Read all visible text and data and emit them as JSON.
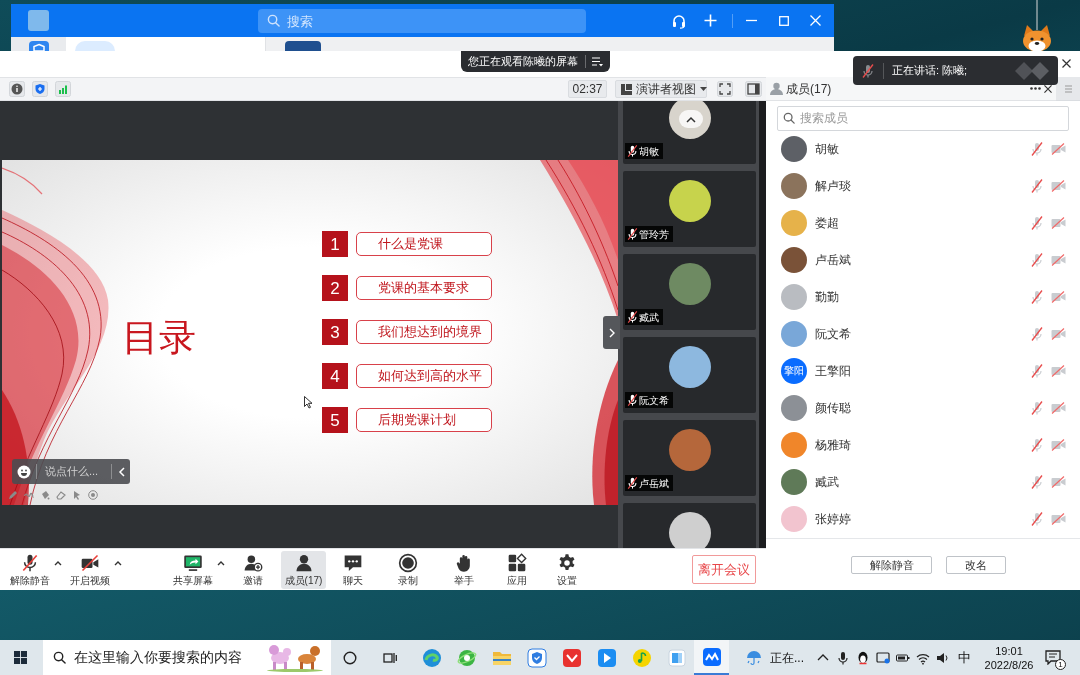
{
  "background_window": {
    "search": {
      "placeholder": "搜索"
    }
  },
  "meeting": {
    "banner": "您正在观看陈曦的屏幕",
    "timer": "02:37",
    "view_mode": "演讲者视图",
    "slide": {
      "title": "目录",
      "items": [
        {
          "number": "1",
          "label": "什么是党课"
        },
        {
          "number": "2",
          "label": "党课的基本要求"
        },
        {
          "number": "3",
          "label": "我们想达到的境界"
        },
        {
          "number": "4",
          "label": "如何达到高的水平"
        },
        {
          "number": "5",
          "label": "后期党课计划"
        }
      ]
    },
    "chat_input": {
      "placeholder": "说点什么..."
    },
    "video_tiles": [
      {
        "kind": "named",
        "name": "胡敏",
        "mic_muted": true
      },
      {
        "kind": "named",
        "name": "管玲芳",
        "mic_muted": true
      },
      {
        "kind": "named",
        "name": "臧武",
        "mic_muted": true
      },
      {
        "kind": "named",
        "name": "阮文希",
        "mic_muted": true
      },
      {
        "kind": "named",
        "name": "卢岳斌",
        "mic_muted": true
      },
      {
        "kind": "cut"
      }
    ],
    "toolbar": [
      {
        "label": "解除静音",
        "has_menu": true,
        "selected": false
      },
      {
        "label": "开启视频",
        "has_menu": true,
        "selected": false
      },
      {
        "label": "共享屏幕",
        "has_menu": true,
        "selected": false
      },
      {
        "label": "邀请",
        "has_menu": false,
        "selected": false
      },
      {
        "label": "成员(17)",
        "has_menu": false,
        "selected": true
      },
      {
        "label": "聊天",
        "has_menu": false,
        "selected": false
      },
      {
        "label": "录制",
        "has_menu": false,
        "selected": false
      },
      {
        "label": "举手",
        "has_menu": false,
        "selected": false
      },
      {
        "label": "应用",
        "has_menu": false,
        "selected": false
      },
      {
        "label": "设置",
        "has_menu": false,
        "selected": false
      }
    ],
    "leave_button": "离开会议"
  },
  "speaking_notice": {
    "text": "正在讲话: 陈曦;"
  },
  "members_panel": {
    "title": "成员(17)",
    "search": {
      "placeholder": "搜索成员"
    },
    "members": [
      {
        "name": "胡敏",
        "mic_muted": true,
        "camera_off": true
      },
      {
        "name": "解卢琰",
        "mic_muted": true,
        "camera_off": true
      },
      {
        "name": "娄超",
        "mic_muted": true,
        "camera_off": true
      },
      {
        "name": "卢岳斌",
        "mic_muted": true,
        "camera_off": true
      },
      {
        "name": "勤勤",
        "mic_muted": true,
        "camera_off": true
      },
      {
        "name": "阮文希",
        "mic_muted": true,
        "camera_off": true
      },
      {
        "name": "王擎阳",
        "avatar_text": "擎阳",
        "mic_muted": true,
        "camera_off": true
      },
      {
        "name": "颜传聪",
        "mic_muted": true,
        "camera_off": true
      },
      {
        "name": "杨雅琦",
        "mic_muted": true,
        "camera_off": true
      },
      {
        "name": "臧武",
        "mic_muted": true,
        "camera_off": true
      },
      {
        "name": "张婷婷",
        "mic_muted": true,
        "camera_off": true
      }
    ],
    "buttons": [
      "解除静音",
      "改名"
    ]
  },
  "taskbar": {
    "search": {
      "placeholder": "在这里输入你要搜索的内容"
    },
    "apps": [
      {
        "selected": false
      },
      {
        "selected": false
      },
      {
        "selected": false
      },
      {
        "selected": false
      },
      {
        "selected": false
      },
      {
        "selected": false
      },
      {
        "selected": false
      },
      {
        "selected": false
      },
      {
        "selected": true
      }
    ],
    "weather": "正在...",
    "input_method": "中",
    "time": "19:01",
    "date": "2022/8/26",
    "notification_count": "1"
  }
}
